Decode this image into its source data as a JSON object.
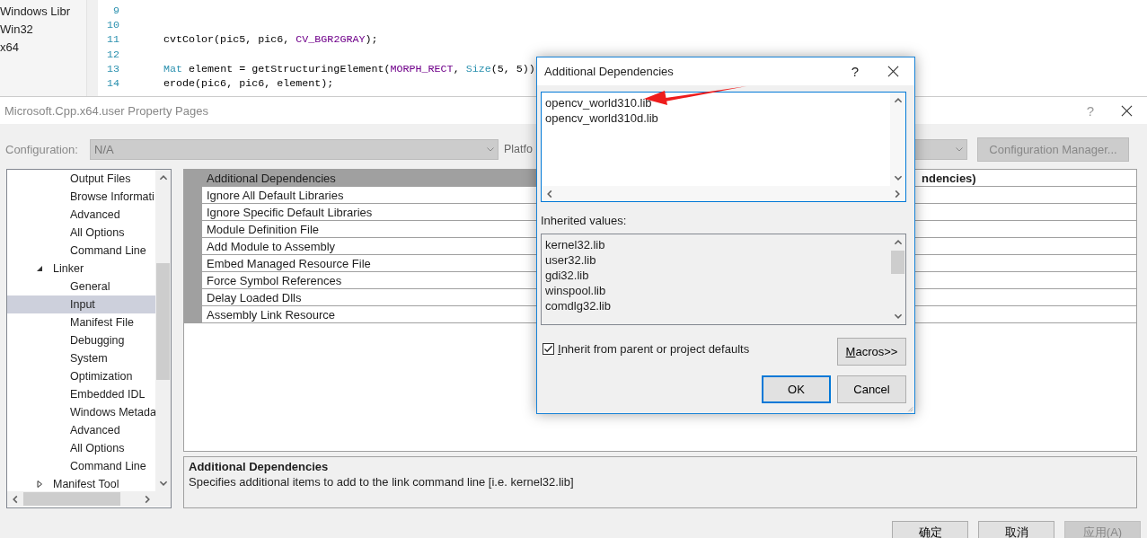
{
  "editor": {
    "solution_items": [
      "Windows Libr",
      "Win32",
      "x64"
    ],
    "lines": [
      {
        "number": "9"
      },
      {
        "number": "10"
      },
      {
        "number": "11",
        "tokens": [
          {
            "text": "cvtColor(pic5, pic6, ",
            "kind": "plain"
          },
          {
            "text": "CV_BGR2GRAY",
            "kind": "macro"
          },
          {
            "text": ");",
            "kind": "plain"
          }
        ]
      },
      {
        "number": "12"
      },
      {
        "number": "13",
        "tokens": [
          {
            "text": "Mat",
            "kind": "type"
          },
          {
            "text": " element = getStructuringElement(",
            "kind": "plain"
          },
          {
            "text": "MORPH_RECT",
            "kind": "macro"
          },
          {
            "text": ", ",
            "kind": "plain"
          },
          {
            "text": "Size",
            "kind": "type"
          },
          {
            "text": "(5, 5))",
            "kind": "plain"
          }
        ]
      },
      {
        "number": "14",
        "tokens": [
          {
            "text": "erode(pic6, pic6, element);",
            "kind": "plain"
          }
        ]
      }
    ]
  },
  "property_pages": {
    "title": "Microsoft.Cpp.x64.user Property Pages",
    "help": "?",
    "configuration_label": "Configuration:",
    "configuration_value": "N/A",
    "platform_label": "Platfo",
    "configuration_manager_button": "Configuration Manager...",
    "tree": [
      {
        "children": [
          {
            "label": "Output Files",
            "selected": false
          },
          {
            "label": "Browse Informati",
            "selected": false
          },
          {
            "label": "Advanced",
            "selected": false
          },
          {
            "label": "All Options",
            "selected": false
          },
          {
            "label": "Command Line",
            "selected": false
          }
        ]
      },
      {
        "label": "Linker",
        "selected": false,
        "expanded": true,
        "children": [
          {
            "label": "General",
            "selected": false
          },
          {
            "label": "Input",
            "selected": true
          },
          {
            "label": "Manifest File",
            "selected": false
          },
          {
            "label": "Debugging",
            "selected": false
          },
          {
            "label": "System",
            "selected": false
          },
          {
            "label": "Optimization",
            "selected": false
          },
          {
            "label": "Embedded IDL",
            "selected": false
          },
          {
            "label": "Windows Metada",
            "selected": false
          },
          {
            "label": "Advanced",
            "selected": false
          },
          {
            "label": "All Options",
            "selected": false
          },
          {
            "label": "Command Line",
            "selected": false
          }
        ]
      },
      {
        "label": "Manifest Tool",
        "selected": false,
        "expanded": false
      }
    ],
    "properties": [
      {
        "name": "Additional Dependencies",
        "value": "ndencies)",
        "selected": true
      },
      {
        "name": "Ignore All Default Libraries",
        "selected": false
      },
      {
        "name": "Ignore Specific Default Libraries",
        "selected": false
      },
      {
        "name": "Module Definition File",
        "selected": false
      },
      {
        "name": "Add Module to Assembly",
        "selected": false
      },
      {
        "name": "Embed Managed Resource File",
        "selected": false
      },
      {
        "name": "Force Symbol References",
        "selected": false
      },
      {
        "name": "Delay Loaded Dlls",
        "selected": false
      },
      {
        "name": "Assembly Link Resource",
        "selected": false
      }
    ],
    "description": {
      "title": "Additional Dependencies",
      "text": "Specifies additional items to add to the link command line [i.e. kernel32.lib]"
    },
    "buttons": [
      {
        "label": "确定",
        "disabled": false
      },
      {
        "label": "取消",
        "disabled": false
      },
      {
        "label": "应用(A)",
        "disabled": true
      }
    ]
  },
  "dialog": {
    "title": "Additional Dependencies",
    "help": "?",
    "values": [
      "opencv_world310.lib",
      "opencv_world310d.lib"
    ],
    "inherited_label": "Inherited values:",
    "inherited_values": [
      "kernel32.lib",
      "user32.lib",
      "gdi32.lib",
      "winspool.lib",
      "comdlg32.lib"
    ],
    "inherit_checkbox": {
      "label": "Inherit from parent or project defaults",
      "checked": true
    },
    "macros_button": "Macros>>",
    "ok_button": "OK",
    "cancel_button": "Cancel"
  }
}
